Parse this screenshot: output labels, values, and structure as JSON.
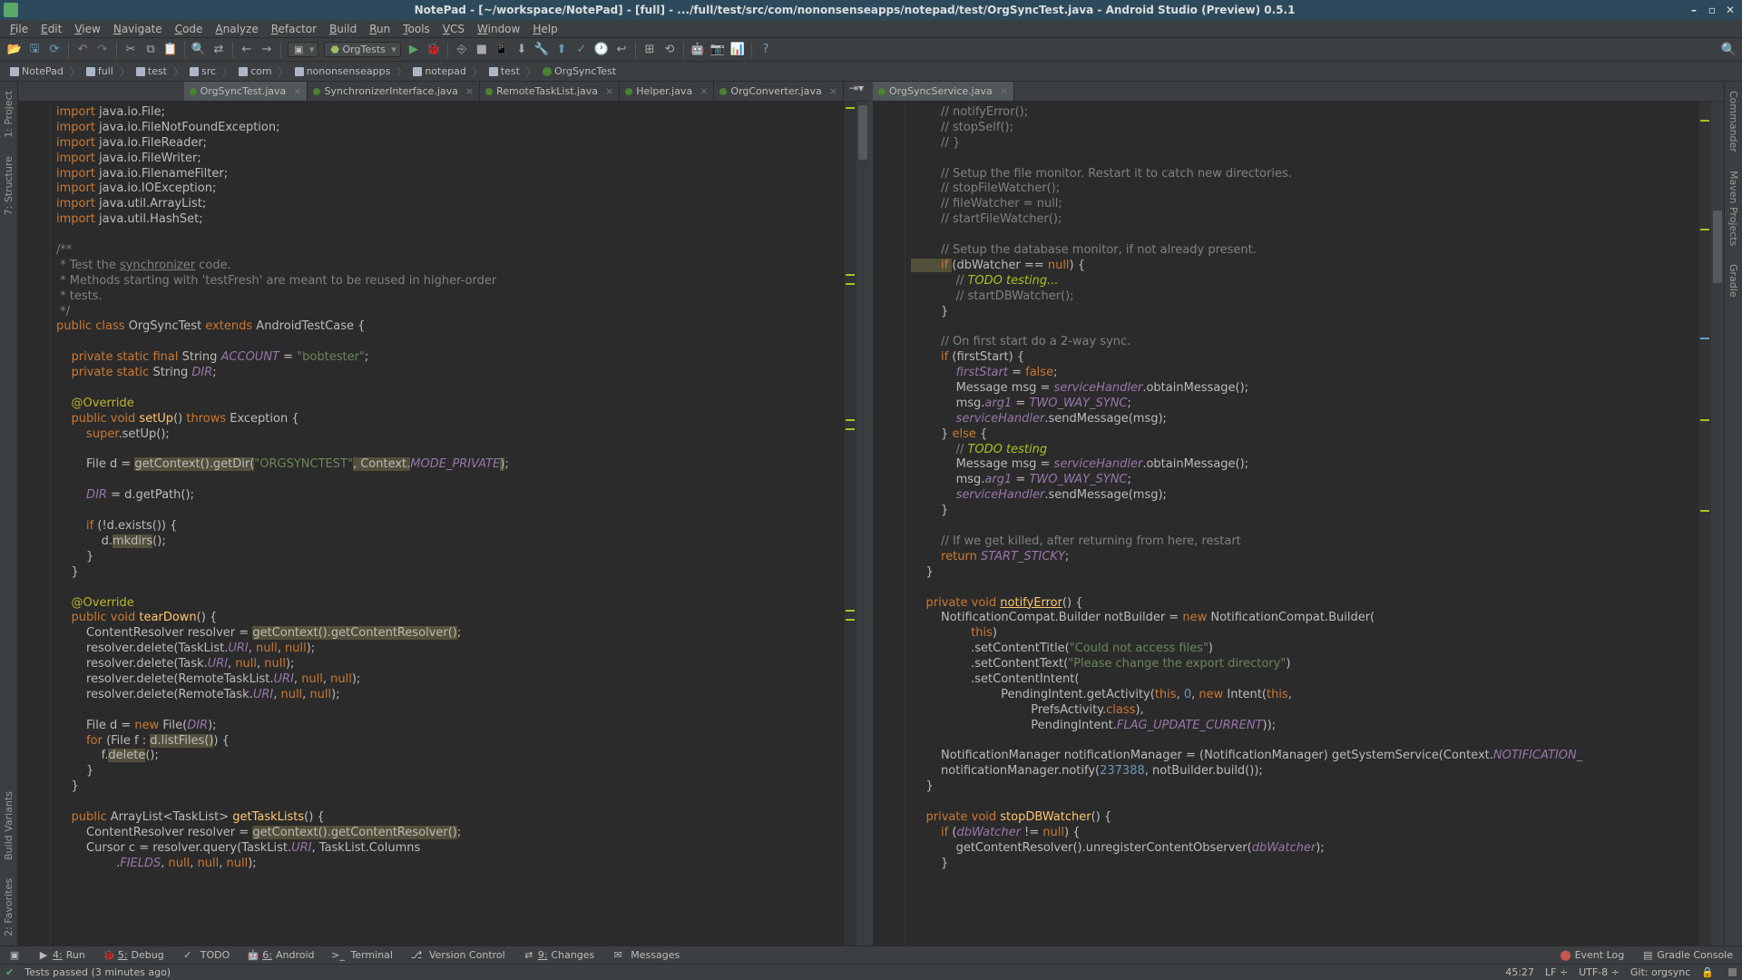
{
  "title": "NotePad - [~/workspace/NotePad] - [full] - .../full/test/src/com/nononsenseapps/notepad/test/OrgSyncTest.java - Android Studio (Preview) 0.5.1",
  "menu": [
    "File",
    "Edit",
    "View",
    "Navigate",
    "Code",
    "Analyze",
    "Refactor",
    "Build",
    "Run",
    "Tools",
    "VCS",
    "Window",
    "Help"
  ],
  "toolbar": {
    "run_config": "OrgTests"
  },
  "breadcrumb": [
    "NotePad",
    "full",
    "test",
    "src",
    "com",
    "nononsenseapps",
    "notepad",
    "test",
    "OrgSyncTest"
  ],
  "left_tools": [
    "1: Project",
    "7: Structure"
  ],
  "right_tools": [
    "Commander",
    "Maven Projects",
    "Gradle"
  ],
  "bottom_left": [
    "Build Variants",
    "2: Favorites"
  ],
  "tabs_left": [
    {
      "label": "OrgSyncTest.java",
      "active": true
    },
    {
      "label": "SynchronizerInterface.java"
    },
    {
      "label": "RemoteTaskList.java"
    },
    {
      "label": "Helper.java"
    },
    {
      "label": "OrgConverter.java"
    }
  ],
  "tabs_right": [
    {
      "label": "OrgSyncService.java",
      "active": true
    }
  ],
  "bottom_tabs_left": [
    {
      "num": "4:",
      "label": "Run"
    },
    {
      "num": "5:",
      "label": "Debug"
    },
    {
      "num": "",
      "label": "TODO"
    },
    {
      "num": "6:",
      "label": "Android"
    },
    {
      "num": "",
      "label": "Terminal"
    },
    {
      "num": "",
      "label": "Version Control"
    },
    {
      "num": "9:",
      "label": "Changes"
    },
    {
      "num": "",
      "label": "Messages"
    }
  ],
  "bottom_tabs_right": [
    "Event Log",
    "Gradle Console"
  ],
  "status": {
    "msg": "Tests passed (3 minutes ago)",
    "pos": "45:27",
    "lf": "LF",
    "enc": "UTF-8",
    "git": "Git: orgsync"
  },
  "code_left": [
    [
      {
        "t": "import ",
        "c": "kw"
      },
      {
        "t": "java.io.File;"
      }
    ],
    [
      {
        "t": "import ",
        "c": "kw"
      },
      {
        "t": "java.io.FileNotFoundException;"
      }
    ],
    [
      {
        "t": "import ",
        "c": "kw"
      },
      {
        "t": "java.io.FileReader;"
      }
    ],
    [
      {
        "t": "import ",
        "c": "kw"
      },
      {
        "t": "java.io.FileWriter;"
      }
    ],
    [
      {
        "t": "import ",
        "c": "kw"
      },
      {
        "t": "java.io.FilenameFilter;"
      }
    ],
    [
      {
        "t": "import ",
        "c": "kw"
      },
      {
        "t": "java.io.IOException;"
      }
    ],
    [
      {
        "t": "import ",
        "c": "kw"
      },
      {
        "t": "java.util.ArrayList;"
      }
    ],
    [
      {
        "t": "import ",
        "c": "kw"
      },
      {
        "t": "java.util.HashSet;"
      }
    ],
    [
      {
        "t": ""
      }
    ],
    [
      {
        "t": "/**",
        "c": "cmt"
      }
    ],
    [
      {
        "t": " * Test the ",
        "c": "cmt"
      },
      {
        "t": "synchronizer",
        "c": "cmt",
        "u": 1
      },
      {
        "t": " code.",
        "c": "cmt"
      }
    ],
    [
      {
        "t": " * Methods starting with 'testFresh' are meant to be reused in higher-order",
        "c": "cmt"
      }
    ],
    [
      {
        "t": " * tests.",
        "c": "cmt"
      }
    ],
    [
      {
        "t": " */",
        "c": "cmt"
      }
    ],
    [
      {
        "t": "public class ",
        "c": "kw"
      },
      {
        "t": "OrgSyncTest "
      },
      {
        "t": "extends ",
        "c": "kw"
      },
      {
        "t": "AndroidTestCase {"
      }
    ],
    [
      {
        "t": ""
      }
    ],
    [
      {
        "t": "    private static final ",
        "c": "kw"
      },
      {
        "t": "String "
      },
      {
        "t": "ACCOUNT",
        "c": "fld"
      },
      {
        "t": " = "
      },
      {
        "t": "\"bobtester\"",
        "c": "str"
      },
      {
        "t": ";"
      }
    ],
    [
      {
        "t": "    private static ",
        "c": "kw"
      },
      {
        "t": "String "
      },
      {
        "t": "DIR",
        "c": "fld"
      },
      {
        "t": ";"
      }
    ],
    [
      {
        "t": ""
      }
    ],
    [
      {
        "t": "    @Override",
        "c": "ann"
      }
    ],
    [
      {
        "t": "    public void ",
        "c": "kw"
      },
      {
        "t": "setUp",
        "c": "call"
      },
      {
        "t": "() "
      },
      {
        "t": "throws ",
        "c": "kw"
      },
      {
        "t": "Exception {"
      }
    ],
    [
      {
        "t": "        super",
        "c": "kw"
      },
      {
        "t": ".setUp();"
      }
    ],
    [
      {
        "t": ""
      }
    ],
    [
      {
        "t": "        File d = "
      },
      {
        "t": "getContext().getDir(",
        "c": "warn"
      },
      {
        "t": "\"ORGSYNCTEST\"",
        "c": "str"
      },
      {
        "t": ", Context.",
        "c": "warn"
      },
      {
        "t": "MODE_PRIVATE",
        "c": "fld"
      },
      {
        "t": ")",
        "c": "warn"
      },
      {
        "t": ";"
      }
    ],
    [
      {
        "t": ""
      }
    ],
    [
      {
        "t": "        DIR",
        "c": "fld"
      },
      {
        "t": " = d.getPath();"
      }
    ],
    [
      {
        "t": ""
      }
    ],
    [
      {
        "t": "        if ",
        "c": "kw"
      },
      {
        "t": "(!d.exists()) {"
      }
    ],
    [
      {
        "t": "            d."
      },
      {
        "t": "mkdirs",
        "c": "warn"
      },
      {
        "t": "();"
      }
    ],
    [
      {
        "t": "        }"
      }
    ],
    [
      {
        "t": "    }"
      }
    ],
    [
      {
        "t": ""
      }
    ],
    [
      {
        "t": "    @Override",
        "c": "ann"
      }
    ],
    [
      {
        "t": "    public void ",
        "c": "kw"
      },
      {
        "t": "tearDown",
        "c": "call"
      },
      {
        "t": "() {"
      }
    ],
    [
      {
        "t": "        ContentResolver resolver = "
      },
      {
        "t": "getContext().getContentResolver()",
        "c": "warn"
      },
      {
        "t": ";"
      }
    ],
    [
      {
        "t": "        resolver.delete(TaskList."
      },
      {
        "t": "URI",
        "c": "fld"
      },
      {
        "t": ", "
      },
      {
        "t": "null",
        "c": "kw"
      },
      {
        "t": ", "
      },
      {
        "t": "null",
        "c": "kw"
      },
      {
        "t": ");"
      }
    ],
    [
      {
        "t": "        resolver.delete(Task."
      },
      {
        "t": "URI",
        "c": "fld"
      },
      {
        "t": ", "
      },
      {
        "t": "null",
        "c": "kw"
      },
      {
        "t": ", "
      },
      {
        "t": "null",
        "c": "kw"
      },
      {
        "t": ");"
      }
    ],
    [
      {
        "t": "        resolver.delete(RemoteTaskList."
      },
      {
        "t": "URI",
        "c": "fld"
      },
      {
        "t": ", "
      },
      {
        "t": "null",
        "c": "kw"
      },
      {
        "t": ", "
      },
      {
        "t": "null",
        "c": "kw"
      },
      {
        "t": ");"
      }
    ],
    [
      {
        "t": "        resolver.delete(RemoteTask."
      },
      {
        "t": "URI",
        "c": "fld"
      },
      {
        "t": ", "
      },
      {
        "t": "null",
        "c": "kw"
      },
      {
        "t": ", "
      },
      {
        "t": "null",
        "c": "kw"
      },
      {
        "t": ");"
      }
    ],
    [
      {
        "t": ""
      }
    ],
    [
      {
        "t": "        File d = "
      },
      {
        "t": "new ",
        "c": "kw"
      },
      {
        "t": "File("
      },
      {
        "t": "DIR",
        "c": "fld"
      },
      {
        "t": ");"
      }
    ],
    [
      {
        "t": "        for ",
        "c": "kw"
      },
      {
        "t": "(File f : "
      },
      {
        "t": "d.listFiles()",
        "c": "warn"
      },
      {
        "t": ") {"
      }
    ],
    [
      {
        "t": "            f."
      },
      {
        "t": "delete",
        "c": "warn"
      },
      {
        "t": "();"
      }
    ],
    [
      {
        "t": "        }"
      }
    ],
    [
      {
        "t": "    }"
      }
    ],
    [
      {
        "t": ""
      }
    ],
    [
      {
        "t": "    public ",
        "c": "kw"
      },
      {
        "t": "ArrayList<TaskList> "
      },
      {
        "t": "getTaskLists",
        "c": "call"
      },
      {
        "t": "() {"
      }
    ],
    [
      {
        "t": "        ContentResolver resolver = "
      },
      {
        "t": "getContext().getContentResolver()",
        "c": "warn"
      },
      {
        "t": ";"
      }
    ],
    [
      {
        "t": "        Cursor c = resolver.query(TaskList."
      },
      {
        "t": "URI",
        "c": "fld"
      },
      {
        "t": ", TaskList.Columns"
      }
    ],
    [
      {
        "t": "                ."
      },
      {
        "t": "FIELDS",
        "c": "fld"
      },
      {
        "t": ", "
      },
      {
        "t": "null",
        "c": "kw"
      },
      {
        "t": ", "
      },
      {
        "t": "null",
        "c": "kw"
      },
      {
        "t": ", "
      },
      {
        "t": "null",
        "c": "kw"
      },
      {
        "t": ");"
      }
    ]
  ],
  "code_right": [
    [
      {
        "t": "        // notifyError();",
        "c": "cmt"
      }
    ],
    [
      {
        "t": "        // stopSelf();",
        "c": "cmt"
      }
    ],
    [
      {
        "t": "        // }",
        "c": "cmt"
      }
    ],
    [
      {
        "t": ""
      }
    ],
    [
      {
        "t": "        // Setup the file monitor. Restart it to catch new directories.",
        "c": "cmt"
      }
    ],
    [
      {
        "t": "        // stopFileWatcher();",
        "c": "cmt"
      }
    ],
    [
      {
        "t": "        // fileWatcher = null;",
        "c": "cmt"
      }
    ],
    [
      {
        "t": "        // startFileWatcher();",
        "c": "cmt"
      }
    ],
    [
      {
        "t": ""
      }
    ],
    [
      {
        "t": "        // Setup the database monitor, if not already present.",
        "c": "cmt"
      }
    ],
    [
      {
        "t": "        if ",
        "c": "kw warn"
      },
      {
        "t": "(dbWatcher == "
      },
      {
        "t": "null",
        "c": "kw"
      },
      {
        "t": ") {"
      }
    ],
    [
      {
        "t": "            // ",
        "c": "cmt"
      },
      {
        "t": "TODO testing...",
        "c": "todo"
      }
    ],
    [
      {
        "t": "            // startDBWatcher();",
        "c": "cmt"
      }
    ],
    [
      {
        "t": "        }"
      }
    ],
    [
      {
        "t": ""
      }
    ],
    [
      {
        "t": "        // On first start do a 2-way sync.",
        "c": "cmt"
      }
    ],
    [
      {
        "t": "        if ",
        "c": "kw"
      },
      {
        "t": "(firstStart) {"
      }
    ],
    [
      {
        "t": "            firstStart",
        "c": "fld"
      },
      {
        "t": " = "
      },
      {
        "t": "false",
        "c": "kw"
      },
      {
        "t": ";"
      }
    ],
    [
      {
        "t": "            Message msg = "
      },
      {
        "t": "serviceHandler",
        "c": "fld"
      },
      {
        "t": ".obtainMessage();"
      }
    ],
    [
      {
        "t": "            msg."
      },
      {
        "t": "arg1",
        "c": "fld"
      },
      {
        "t": " = "
      },
      {
        "t": "TWO_WAY_SYNC",
        "c": "fld"
      },
      {
        "t": ";"
      }
    ],
    [
      {
        "t": "            serviceHandler",
        "c": "fld"
      },
      {
        "t": ".sendMessage(msg);"
      }
    ],
    [
      {
        "t": "        } "
      },
      {
        "t": "else ",
        "c": "kw"
      },
      {
        "t": "{"
      }
    ],
    [
      {
        "t": "            // ",
        "c": "cmt"
      },
      {
        "t": "TODO testing",
        "c": "todo"
      }
    ],
    [
      {
        "t": "            Message msg = "
      },
      {
        "t": "serviceHandler",
        "c": "fld"
      },
      {
        "t": ".obtainMessage();"
      }
    ],
    [
      {
        "t": "            msg."
      },
      {
        "t": "arg1",
        "c": "fld"
      },
      {
        "t": " = "
      },
      {
        "t": "TWO_WAY_SYNC",
        "c": "fld"
      },
      {
        "t": ";"
      }
    ],
    [
      {
        "t": "            serviceHandler",
        "c": "fld"
      },
      {
        "t": ".sendMessage(msg);"
      }
    ],
    [
      {
        "t": "        }"
      }
    ],
    [
      {
        "t": ""
      }
    ],
    [
      {
        "t": "        // If we get killed, after returning from here, restart",
        "c": "cmt"
      }
    ],
    [
      {
        "t": "        return ",
        "c": "kw"
      },
      {
        "t": "START_STICKY",
        "c": "fld"
      },
      {
        "t": ";"
      }
    ],
    [
      {
        "t": "    }"
      }
    ],
    [
      {
        "t": ""
      }
    ],
    [
      {
        "t": "    private void ",
        "c": "kw"
      },
      {
        "t": "notifyError",
        "c": "call",
        "u": 1
      },
      {
        "t": "() {"
      }
    ],
    [
      {
        "t": "        NotificationCompat.Builder notBuilder = "
      },
      {
        "t": "new ",
        "c": "kw"
      },
      {
        "t": "NotificationCompat.Builder("
      }
    ],
    [
      {
        "t": "                this",
        "c": "kw"
      },
      {
        "t": ")"
      }
    ],
    [
      {
        "t": "                .setContentTitle("
      },
      {
        "t": "\"Could not access files\"",
        "c": "str"
      },
      {
        "t": ")"
      }
    ],
    [
      {
        "t": "                .setContentText("
      },
      {
        "t": "\"Please change the export directory\"",
        "c": "str"
      },
      {
        "t": ")"
      }
    ],
    [
      {
        "t": "                .setContentIntent("
      }
    ],
    [
      {
        "t": "                        PendingIntent.getActivity("
      },
      {
        "t": "this",
        "c": "kw"
      },
      {
        "t": ", "
      },
      {
        "t": "0",
        "c": "num"
      },
      {
        "t": ", "
      },
      {
        "t": "new ",
        "c": "kw"
      },
      {
        "t": "Intent("
      },
      {
        "t": "this",
        "c": "kw"
      },
      {
        "t": ","
      }
    ],
    [
      {
        "t": "                                PrefsActivity."
      },
      {
        "t": "class",
        "c": "kw"
      },
      {
        "t": "),"
      }
    ],
    [
      {
        "t": "                                PendingIntent."
      },
      {
        "t": "FLAG_UPDATE_CURRENT",
        "c": "fld"
      },
      {
        "t": "));"
      }
    ],
    [
      {
        "t": ""
      }
    ],
    [
      {
        "t": "        NotificationManager notificationManager = (NotificationManager) getSystemService(Context."
      },
      {
        "t": "NOTIFICATION_",
        "c": "fld"
      }
    ],
    [
      {
        "t": "        notificationManager.notify("
      },
      {
        "t": "237388",
        "c": "num"
      },
      {
        "t": ", notBuilder.build());"
      }
    ],
    [
      {
        "t": "    }"
      }
    ],
    [
      {
        "t": ""
      }
    ],
    [
      {
        "t": "    private void ",
        "c": "kw"
      },
      {
        "t": "stopDBWatcher",
        "c": "call"
      },
      {
        "t": "() {"
      }
    ],
    [
      {
        "t": "        if ",
        "c": "kw"
      },
      {
        "t": "("
      },
      {
        "t": "dbWatcher",
        "c": "fld"
      },
      {
        "t": " != "
      },
      {
        "t": "null",
        "c": "kw"
      },
      {
        "t": ") {"
      }
    ],
    [
      {
        "t": "            getContentResolver().unregisterContentObserver("
      },
      {
        "t": "dbWatcher",
        "c": "fld"
      },
      {
        "t": ");"
      }
    ],
    [
      {
        "t": "        }"
      }
    ]
  ]
}
